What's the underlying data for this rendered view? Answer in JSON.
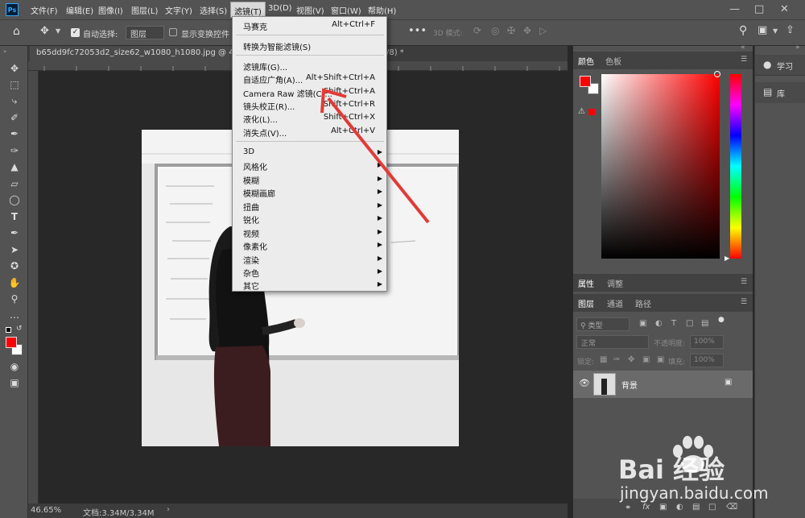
{
  "menubar": {
    "items": [
      "文件(F)",
      "编辑(E)",
      "图像(I)",
      "图层(L)",
      "文字(Y)",
      "选择(S)",
      "滤镜(T)",
      "3D(D)",
      "视图(V)",
      "窗口(W)",
      "帮助(H)"
    ]
  },
  "app": {
    "logo": "Ps"
  },
  "options": {
    "auto_select_label": "自动选择:",
    "layer_select": "图层",
    "show_transform_label": "显示变换控件",
    "mode_3d_label": "3D 模式:"
  },
  "document": {
    "tab_title": "b65dd9fc72053d2_size62_w1080_h1080.jpg @ 46.7%(RG",
    "tab_title_tail": "/8) *"
  },
  "status": {
    "zoom": "46.65%",
    "doc_info": "文档:3.34M/3.34M"
  },
  "filter_menu": {
    "top": [
      {
        "label": "马赛克",
        "shortcut": "Alt+Ctrl+F"
      }
    ],
    "smart": [
      {
        "label": "转换为智能滤镜(S)",
        "shortcut": ""
      }
    ],
    "group1": [
      {
        "label": "滤镜库(G)...",
        "shortcut": ""
      },
      {
        "label": "自适应广角(A)...",
        "shortcut": "Alt+Shift+Ctrl+A"
      },
      {
        "label": "Camera Raw 滤镜(C)...",
        "shortcut": "Shift+Ctrl+A"
      },
      {
        "label": "镜头校正(R)...",
        "shortcut": "Shift+Ctrl+R"
      },
      {
        "label": "液化(L)...",
        "shortcut": "Shift+Ctrl+X"
      },
      {
        "label": "消失点(V)...",
        "shortcut": "Alt+Ctrl+V"
      }
    ],
    "submenus": [
      "3D",
      "风格化",
      "模糊",
      "模糊画廊",
      "扭曲",
      "锐化",
      "视频",
      "像素化",
      "渲染",
      "杂色",
      "其它"
    ]
  },
  "panels": {
    "color_tab": "颜色",
    "swatch_tab": "色板",
    "props_tab": "属性",
    "adjust_tab": "调整",
    "layers_tab": "图层",
    "channels_tab": "通道",
    "paths_tab": "路径",
    "kind_filter": "类型",
    "blend_mode": "正常",
    "opacity_label": "不透明度:",
    "opacity_value": "100%",
    "lock_label": "锁定:",
    "fill_label": "填充:",
    "fill_value": "100%",
    "layer_name": "背景",
    "learn": "学习",
    "library": "库"
  },
  "colors": {
    "foreground": "#ff0000",
    "background": "#ffffff",
    "accent": "#e53935"
  },
  "watermark": {
    "brand": "Bai 经验",
    "url": "jingyan.baidu.com"
  }
}
